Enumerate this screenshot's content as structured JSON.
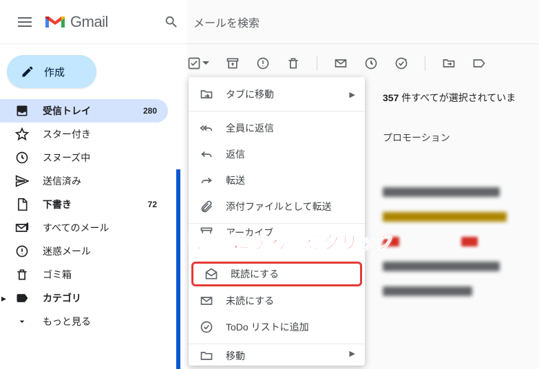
{
  "header": {
    "app_name": "Gmail",
    "search_placeholder": "メールを検索"
  },
  "compose_label": "作成",
  "sidebar": {
    "items": [
      {
        "label": "受信トレイ",
        "count": "280",
        "icon": "inbox"
      },
      {
        "label": "スター付き",
        "icon": "star"
      },
      {
        "label": "スヌーズ中",
        "icon": "clock"
      },
      {
        "label": "送信済み",
        "icon": "send"
      },
      {
        "label": "下書き",
        "count": "72",
        "icon": "draft"
      },
      {
        "label": "すべてのメール",
        "icon": "all-mail"
      },
      {
        "label": "迷惑メール",
        "icon": "spam"
      },
      {
        "label": "ゴミ箱",
        "icon": "trash"
      },
      {
        "label": "カテゴリ",
        "icon": "category"
      },
      {
        "label": "もっと見る",
        "icon": "more"
      }
    ]
  },
  "selection_info": {
    "count_text": "357",
    "rest_text": " 件すべてが選択されていま"
  },
  "tabs": {
    "promotion": "プロモーション"
  },
  "context_menu": {
    "move_to_tab": "タブに移動",
    "reply_all": "全員に返信",
    "reply": "返信",
    "forward": "転送",
    "forward_attachment": "添付ファイルとして転送",
    "archive": "アーカイブ",
    "mark_read": "既読にする",
    "mark_unread": "未読にする",
    "add_todo": "ToDo リストに追加",
    "move": "移動"
  },
  "annotation_text": "『既読にする』をクリック"
}
